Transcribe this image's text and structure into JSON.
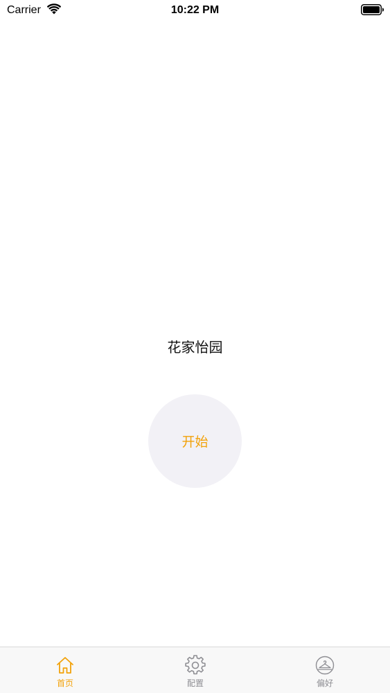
{
  "status_bar": {
    "carrier": "Carrier",
    "time": "10:22 PM",
    "wifi_icon": "wifi-icon",
    "battery_icon": "battery-icon"
  },
  "main": {
    "title": "花家怡园",
    "start_button_label": "开始"
  },
  "tab_bar": {
    "tabs": [
      {
        "label": "首页",
        "icon": "home-icon",
        "active": true
      },
      {
        "label": "配置",
        "icon": "gear-icon",
        "active": false
      },
      {
        "label": "偏好",
        "icon": "hanger-icon",
        "active": false
      }
    ]
  },
  "colors": {
    "accent": "#f2a20a",
    "inactive": "#8e8e93",
    "button_bg": "#f2f1f6",
    "tab_bar_bg": "#f8f8f8"
  }
}
